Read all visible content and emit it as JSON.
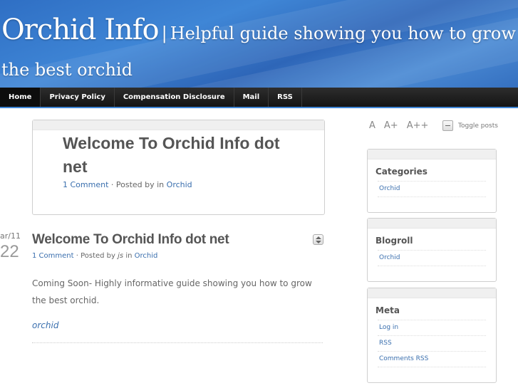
{
  "header": {
    "site_name": "Orchid Info",
    "separator": "|",
    "tagline": "Helpful guide showing you how to grow the best orchid"
  },
  "nav": {
    "items": [
      {
        "label": "Home"
      },
      {
        "label": "Privacy Policy"
      },
      {
        "label": "Compensation Disclosure"
      },
      {
        "label": "Mail"
      },
      {
        "label": "RSS"
      }
    ]
  },
  "featured": {
    "title": "Welcome To Orchid Info dot net",
    "comments": "1 Comment",
    "meta_middle": " · Posted by  in ",
    "category": "Orchid"
  },
  "post": {
    "date_month": "ar/11",
    "date_day": "22",
    "title": "Welcome To Orchid Info dot net",
    "comments": "1 Comment",
    "posted_by": " · Posted by ",
    "author": "js",
    "in": " in ",
    "category": "Orchid",
    "body": "Coming Soon- Highly informative guide showing you how to grow the best orchid.",
    "tag": "orchid"
  },
  "sidebar": {
    "font_sizes": [
      "A",
      "A+",
      "A++"
    ],
    "toggle_posts": "Toggle posts",
    "widgets": [
      {
        "title": "Categories",
        "items": [
          "Orchid"
        ]
      },
      {
        "title": "Blogroll",
        "items": [
          "Orchid"
        ]
      },
      {
        "title": "Meta",
        "items": [
          "Log in",
          "RSS",
          "Comments RSS"
        ]
      }
    ]
  },
  "colors": {
    "link": "#3a6fae",
    "nav_bg": "#1c1c1c",
    "header_blue": "#3f86d6"
  }
}
